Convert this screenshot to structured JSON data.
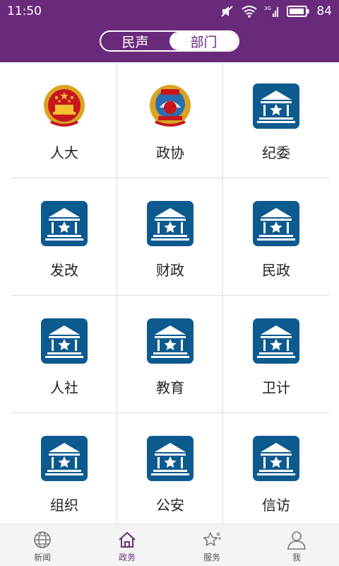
{
  "status": {
    "time": "11:50",
    "battery": "84"
  },
  "header": {
    "tabs": [
      {
        "label": "民声",
        "active": false
      },
      {
        "label": "部门",
        "active": true
      }
    ]
  },
  "departments": [
    {
      "label": "人大",
      "icon": "national-emblem-icon"
    },
    {
      "label": "政协",
      "icon": "cppcc-emblem-icon"
    },
    {
      "label": "纪委",
      "icon": "government-building-icon"
    },
    {
      "label": "发改",
      "icon": "government-building-icon"
    },
    {
      "label": "财政",
      "icon": "government-building-icon"
    },
    {
      "label": "民政",
      "icon": "government-building-icon"
    },
    {
      "label": "人社",
      "icon": "government-building-icon"
    },
    {
      "label": "教育",
      "icon": "government-building-icon"
    },
    {
      "label": "卫计",
      "icon": "government-building-icon"
    },
    {
      "label": "组织",
      "icon": "government-building-icon"
    },
    {
      "label": "公安",
      "icon": "government-building-icon"
    },
    {
      "label": "信访",
      "icon": "government-building-icon"
    }
  ],
  "nav": {
    "items": [
      {
        "label": "新闻",
        "icon": "globe-icon",
        "active": false
      },
      {
        "label": "政务",
        "icon": "home-icon",
        "active": true
      },
      {
        "label": "服务",
        "icon": "star-icon",
        "active": false
      },
      {
        "label": "我",
        "icon": "person-icon",
        "active": false
      }
    ]
  },
  "colors": {
    "primary": "#6a2a7c",
    "tile_blue": "#0d5a8f"
  }
}
